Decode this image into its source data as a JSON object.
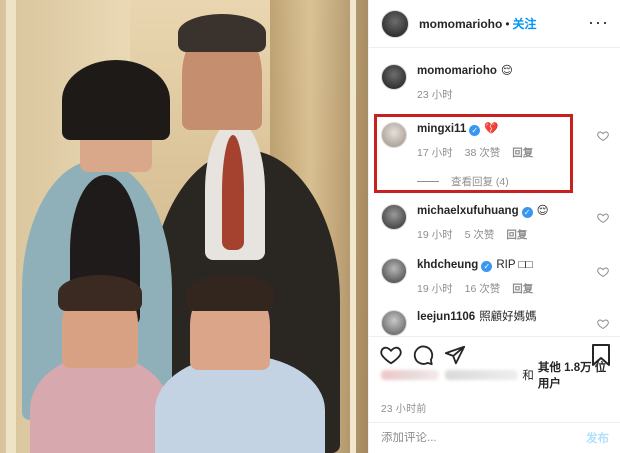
{
  "header": {
    "username": "momomarioho",
    "separator": "•",
    "follow_label": "关注",
    "more_label": "···"
  },
  "comments": [
    {
      "username": "momomarioho",
      "text": "😌",
      "time": "23 小时",
      "likes": "",
      "verified": false
    },
    {
      "username": "mingxi11",
      "text": "💔",
      "time": "17 小时",
      "likes": "38 次赞",
      "reply_label": "回复",
      "verified": true,
      "view_replies": "查看回复 (4)"
    },
    {
      "username": "michaelxufuhuang",
      "text": "😌",
      "time": "19 小时",
      "likes": "5 次赞",
      "reply_label": "回复",
      "verified": true
    },
    {
      "username": "khdcheung",
      "text": "RIP □□",
      "time": "19 小时",
      "likes": "16 次赞",
      "reply_label": "回复",
      "verified": true
    },
    {
      "username": "leejun1106",
      "text": "照顧好媽媽",
      "verified": false
    }
  ],
  "likes_line": {
    "and_text": "和",
    "others_text": "其他 1.8万 位用户"
  },
  "timestamp": "23 小时前",
  "add_comment": {
    "placeholder": "添加评论...",
    "post_label": "发布"
  },
  "colors": {
    "accent_blue": "#0095f6",
    "highlight_red": "#c8201f",
    "muted_text": "#8e8e8e"
  },
  "icons": [
    "heart-icon",
    "comment-icon",
    "share-icon",
    "bookmark-icon",
    "verified-icon",
    "more-icon"
  ]
}
